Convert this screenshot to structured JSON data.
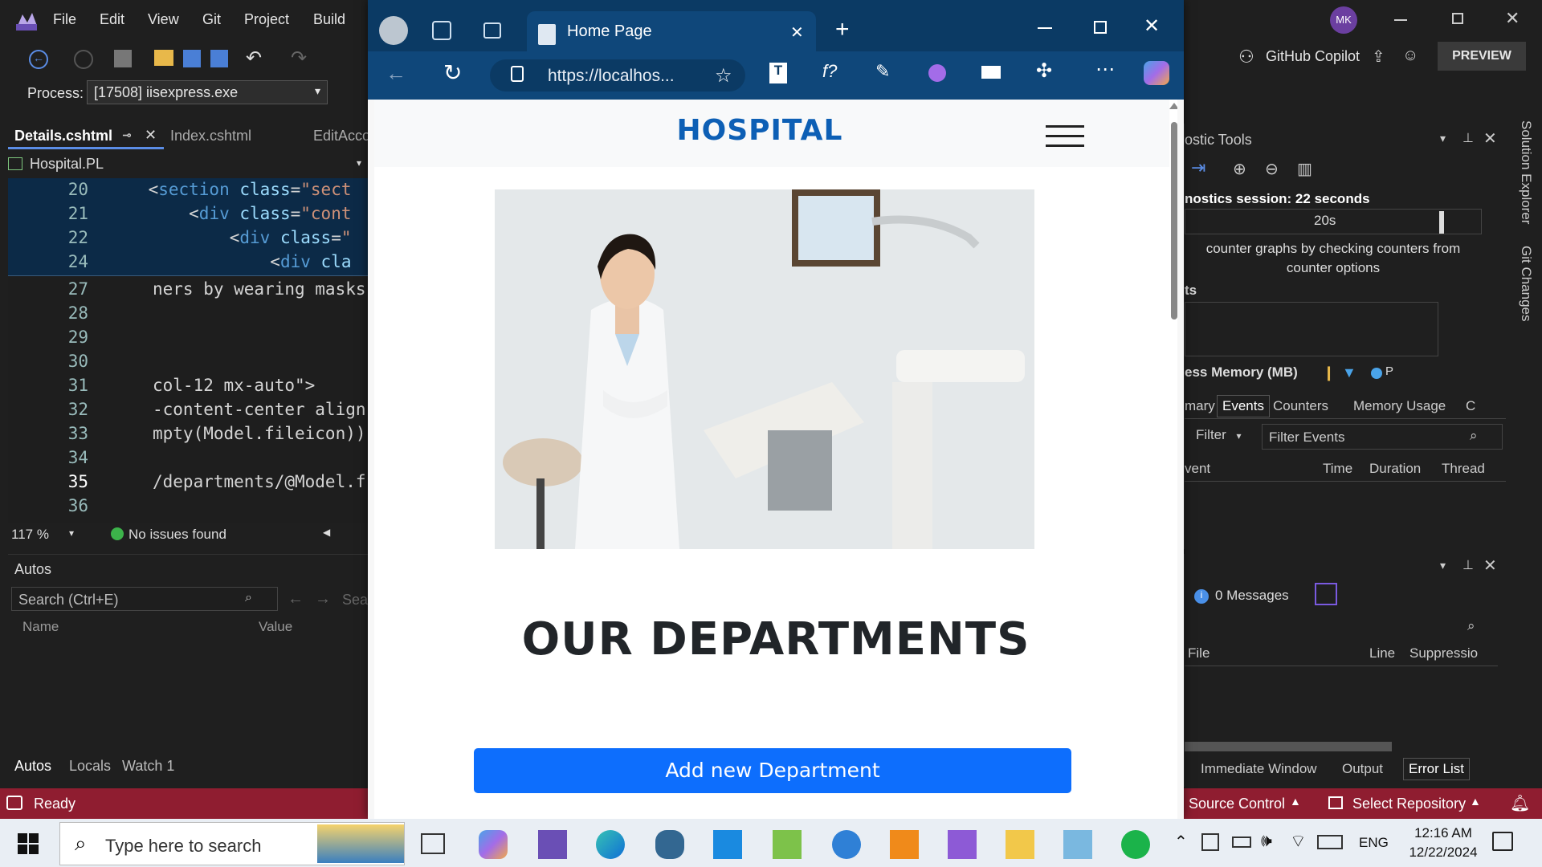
{
  "vs": {
    "menu": [
      "File",
      "Edit",
      "View",
      "Git",
      "Project",
      "Build"
    ],
    "user_initials": "MK",
    "copilot_label": "GitHub Copilot",
    "preview_label": "PREVIEW",
    "process_label": "Process:",
    "process_value": "[17508] iisexpress.exe",
    "tabs": [
      "Details.cshtml",
      "Index.cshtml",
      "EditAcco"
    ],
    "project": "Hospital.PL",
    "sticky_lines": [
      {
        "no": "20",
        "indent": "    ",
        "tag": "section",
        "attr": "class",
        "val": "\"sect"
      },
      {
        "no": "21",
        "indent": "        ",
        "tag": "div",
        "attr": "class",
        "val": "\"cont"
      },
      {
        "no": "22",
        "indent": "            ",
        "tag": "div",
        "attr": "class",
        "val": "\""
      },
      {
        "no": "24",
        "indent": "                ",
        "tag": "div",
        "attr": "cla",
        "val": ""
      }
    ],
    "code_lines": [
      {
        "no": "27",
        "text": "ners by wearing masks"
      },
      {
        "no": "28",
        "text": ""
      },
      {
        "no": "29",
        "text": ""
      },
      {
        "no": "30",
        "text": ""
      },
      {
        "no": "31",
        "text": "col-12 mx-auto\">"
      },
      {
        "no": "32",
        "text": "-content-center align"
      },
      {
        "no": "33",
        "text": "mpty(Model.fileicon))"
      },
      {
        "no": "34",
        "text": ""
      },
      {
        "no": "35",
        "text": "/departments/@Model.f"
      },
      {
        "no": "36",
        "text": ""
      }
    ],
    "zoom": "117 %",
    "issues": "No issues found",
    "autos_title": "Autos",
    "autos_search": "Search (Ctrl+E)",
    "autos_search_depth": "Sear",
    "autos_cols": [
      "Name",
      "Value"
    ],
    "bottom_tabs": [
      "Autos",
      "Locals",
      "Watch 1"
    ],
    "status": "Ready",
    "source_control": "Source Control",
    "select_repo": "Select Repository"
  },
  "diagnostics": {
    "title": "ostic Tools",
    "session": "nostics session: 22 seconds",
    "tick": "20s",
    "hint": "counter graphs by checking counters from counter options",
    "section": "ts",
    "memory": "ess Memory (MB)",
    "mem_legend": "P",
    "tabs": [
      "mary",
      "Events",
      "Counters",
      "Memory Usage",
      "C"
    ],
    "filter": "Filter",
    "filter_events": "Filter Events",
    "cols": [
      "vent",
      "Time",
      "Duration",
      "Thread"
    ]
  },
  "errors": {
    "messages": "0 Messages",
    "cols": [
      "File",
      "Line",
      "Suppressio"
    ],
    "bottom_tabs": [
      "Immediate Window",
      "Output",
      "Error List"
    ]
  },
  "side_tabs": [
    "Solution Explorer",
    "Git Changes"
  ],
  "edge": {
    "tab_title": "Home Page",
    "url": "https://localhos...",
    "site": {
      "brand": "HOSPITAL",
      "heading": "OUR DEPARTMENTS",
      "add_button": "Add new Department"
    }
  },
  "taskbar": {
    "search_placeholder": "Type here to search",
    "lang": "ENG",
    "time": "12:16 AM",
    "date": "12/22/2024"
  },
  "colors": {
    "status_bar": "#8f1d30",
    "edge_title": "#0b3a64",
    "brand": "#0d5fb5",
    "button": "#0d6efd"
  }
}
